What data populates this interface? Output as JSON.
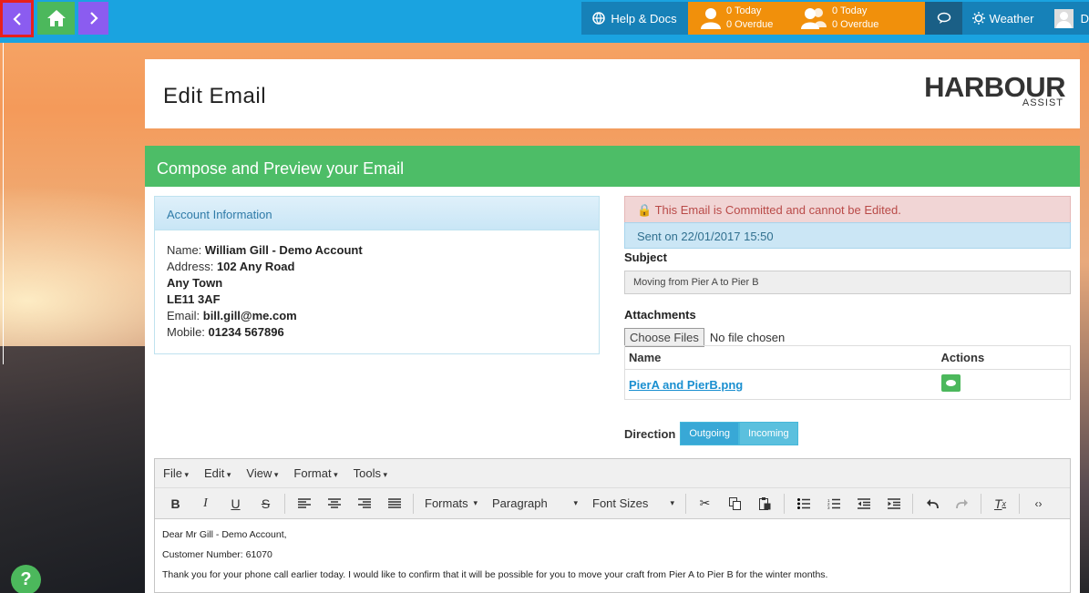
{
  "topbar": {
    "help_label": "Help & Docs",
    "tasks_today_1": "0 Today",
    "tasks_overdue_1": "0 Overdue",
    "tasks_today_2": "0 Today",
    "tasks_overdue_2": "0 Overdue",
    "weather_label": "Weather",
    "user_initial": "D"
  },
  "header": {
    "title": "Edit Email",
    "logo_main": "HARBOUR",
    "logo_sub": "ASSIST"
  },
  "compose": {
    "title": "Compose and Preview your Email",
    "account": {
      "heading": "Account Information",
      "name_label": "Name:",
      "name_value": "William Gill - Demo Account",
      "address_label": "Address:",
      "address_line1": "102 Any Road",
      "address_line2": "Any Town",
      "address_line3": "LE11 3AF",
      "email_label": "Email:",
      "email_value": "bill.gill@me.com",
      "mobile_label": "Mobile:",
      "mobile_value": "01234 567896"
    },
    "committed_alert": "This Email is Committed and cannot be Edited.",
    "sent_info": "Sent on 22/01/2017 15:50",
    "subject_label": "Subject",
    "subject_value": "Moving from Pier A to Pier B",
    "attachments_label": "Attachments",
    "choose_files": "Choose Files",
    "no_file": "No file chosen",
    "table": {
      "col_name": "Name",
      "col_actions": "Actions",
      "row_file": "PierA and PierB.png"
    },
    "direction_label": "Direction",
    "direction_outgoing": "Outgoing",
    "direction_incoming": "Incoming"
  },
  "editor": {
    "menu": [
      "File",
      "Edit",
      "View",
      "Format",
      "Tools"
    ],
    "formats": "Formats",
    "paragraph": "Paragraph",
    "font_sizes": "Font Sizes",
    "body": [
      "Dear Mr Gill - Demo Account,",
      "Customer Number: 61070",
      "Thank you for your phone call earlier today.  I would like to confirm that it will be possible for you to move your craft from Pier A to Pier B for the winter months."
    ]
  },
  "help_bubble": "?"
}
